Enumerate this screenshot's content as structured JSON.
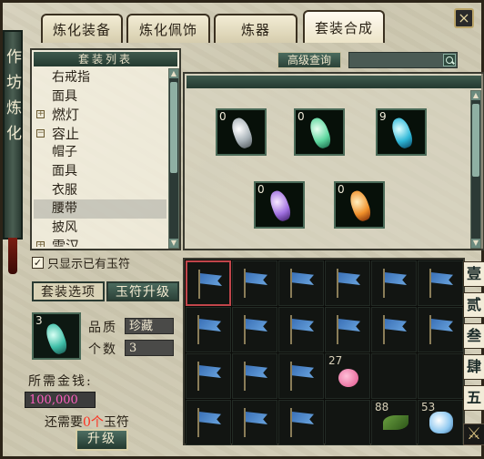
{
  "tabs": [
    {
      "label": "炼化装备"
    },
    {
      "label": "炼化佩饰"
    },
    {
      "label": "炼器"
    },
    {
      "label": "套装合成"
    }
  ],
  "scroll_text": "作坊炼化",
  "list": {
    "title": "套装列表",
    "items": [
      {
        "label": "右戒指",
        "group": false,
        "expander": ""
      },
      {
        "label": "面具",
        "group": false,
        "expander": ""
      },
      {
        "label": "燃灯",
        "group": true,
        "expander": "+"
      },
      {
        "label": "容止",
        "group": true,
        "expander": "−"
      },
      {
        "label": "帽子",
        "group": false,
        "expander": ""
      },
      {
        "label": "面具",
        "group": false,
        "expander": ""
      },
      {
        "label": "衣服",
        "group": false,
        "expander": ""
      },
      {
        "label": "腰带",
        "group": false,
        "expander": "",
        "selected": true
      },
      {
        "label": "披风",
        "group": false,
        "expander": ""
      },
      {
        "label": "雲汉",
        "group": true,
        "expander": "+"
      }
    ]
  },
  "checkbox": {
    "label": "只显示已有玉符",
    "checked": "✓"
  },
  "subtabs": {
    "set_options": "套装选项",
    "jade_upgrade": "玉符升级"
  },
  "detail": {
    "count": "3",
    "quality_label": "品质",
    "quality_value": "珍藏",
    "amount_label": "个数",
    "amount_value": "3"
  },
  "money": {
    "label": "所需金钱:",
    "value": "100,000"
  },
  "need": {
    "prefix": "还需要",
    "count": "0个",
    "suffix": "玉符"
  },
  "upgrade_button": "升级",
  "search": {
    "button": "高级查询"
  },
  "preview_slots": [
    {
      "count": "0",
      "color": "silver"
    },
    {
      "count": "0",
      "color": "jade"
    },
    {
      "count": "9",
      "color": "cyan"
    },
    {
      "count": "0",
      "color": "purple"
    },
    {
      "count": "0",
      "color": "orange"
    }
  ],
  "inventory": {
    "flag_count": 18,
    "items": [
      {
        "count": "27",
        "type": "pink"
      },
      {
        "count": "88",
        "type": "leaf"
      },
      {
        "count": "53",
        "type": "crystal"
      }
    ]
  },
  "side_tabs": [
    "壹",
    "贰",
    "叁",
    "肆",
    "五"
  ],
  "close": "×",
  "colors": {
    "accent": "#2c4238",
    "money": "#ff60c0",
    "warning": "#ff3020"
  }
}
